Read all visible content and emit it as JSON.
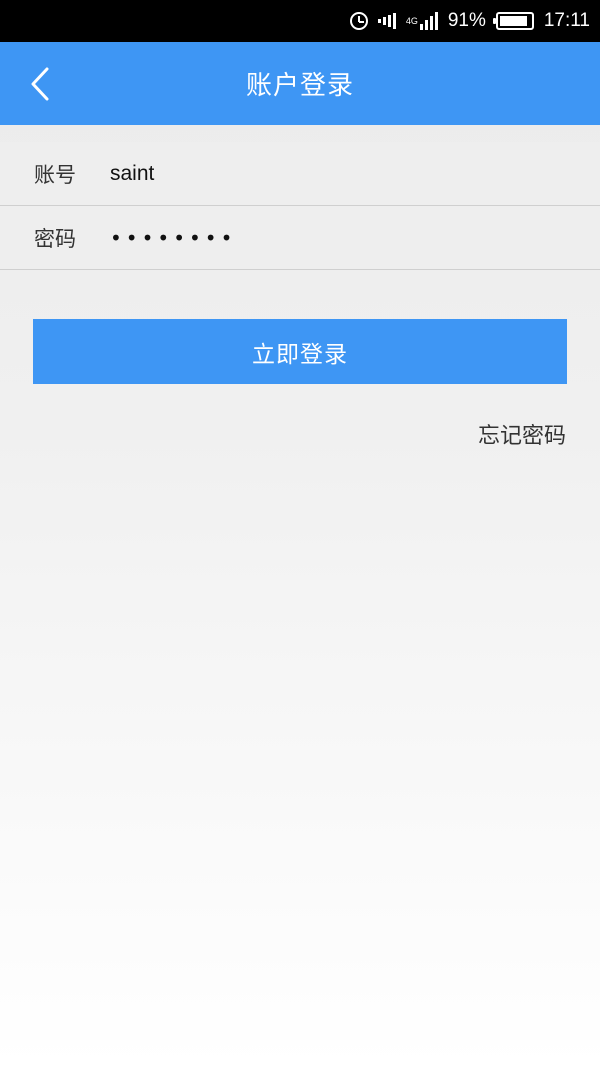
{
  "status_bar": {
    "network": "4G",
    "battery": "91%",
    "battery_level": 0.91,
    "time": "17:11"
  },
  "header": {
    "title": "账户登录",
    "back_icon": "chevron-left-icon"
  },
  "form": {
    "account": {
      "label": "账号",
      "value": "saint"
    },
    "password": {
      "label": "密码",
      "value": "••••••••"
    }
  },
  "actions": {
    "login_label": "立即登录",
    "forgot_label": "忘记密码"
  },
  "colors": {
    "primary": "#3e96f4",
    "status_bar": "#000000"
  }
}
